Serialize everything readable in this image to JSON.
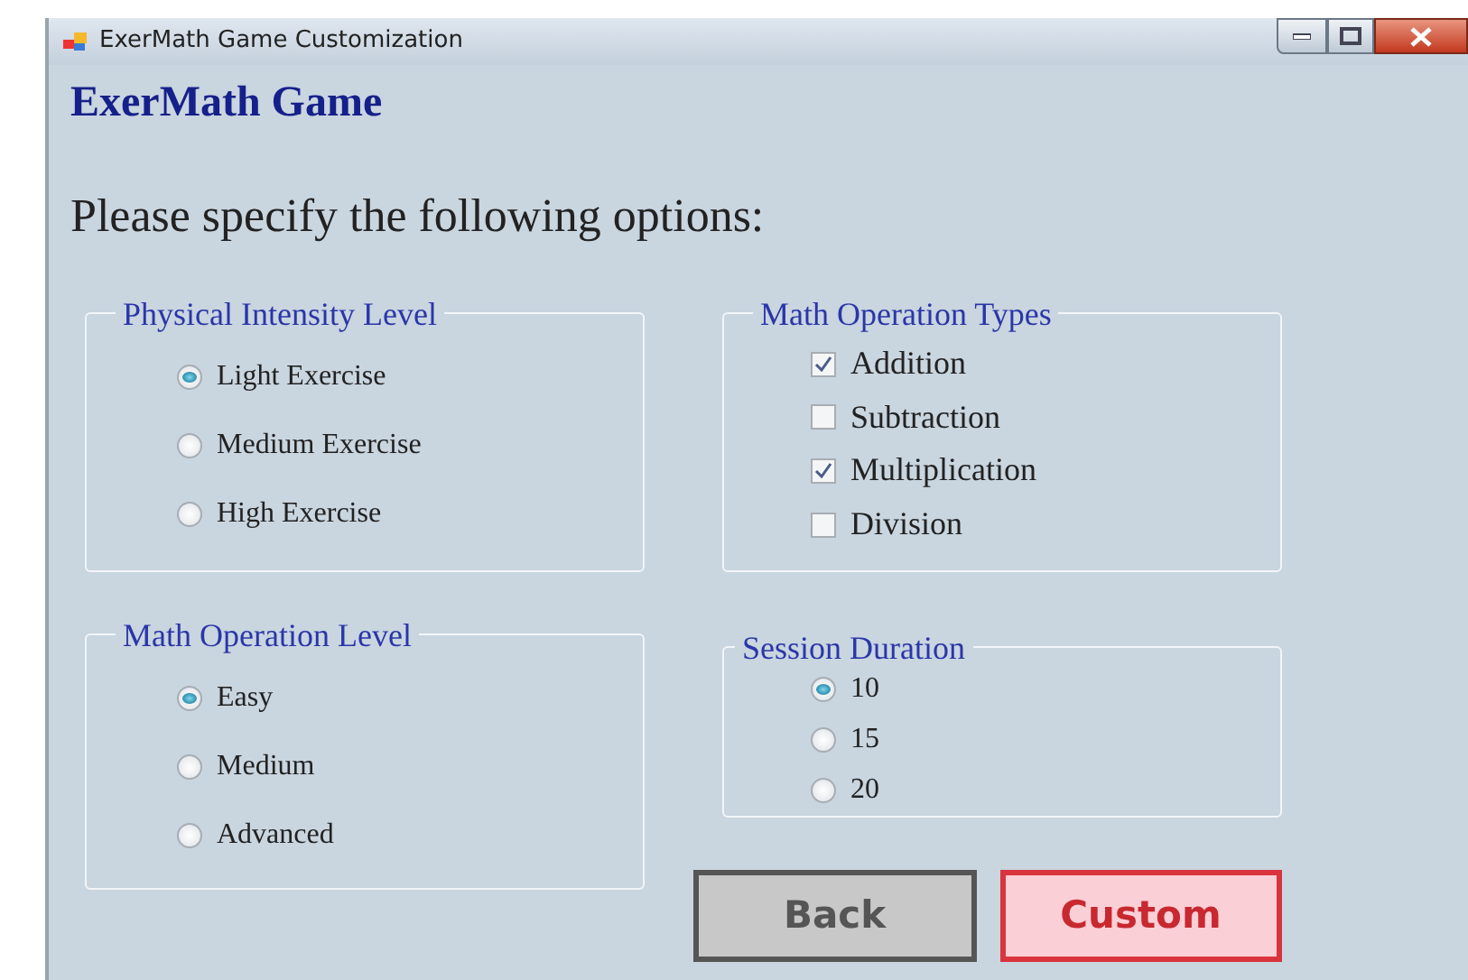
{
  "window": {
    "title": "ExerMath Game  Customization"
  },
  "heading": "ExerMath Game",
  "prompt": "Please specify the following options:",
  "groups": [
    {
      "title": "Physical Intensity Level",
      "kind": "radio",
      "items": [
        {
          "label": "Light Exercise",
          "selected": true
        },
        {
          "label": "Medium Exercise",
          "selected": false
        },
        {
          "label": "High Exercise",
          "selected": false
        }
      ]
    },
    {
      "title": "Math Operation Types",
      "kind": "checkbox",
      "items": [
        {
          "label": "Addition",
          "checked": true
        },
        {
          "label": "Subtraction",
          "checked": false
        },
        {
          "label": "Multiplication",
          "checked": true
        },
        {
          "label": "Division",
          "checked": false
        }
      ]
    },
    {
      "title": "Math Operation Level",
      "kind": "radio",
      "items": [
        {
          "label": "Easy",
          "selected": true
        },
        {
          "label": "Medium",
          "selected": false
        },
        {
          "label": "Advanced",
          "selected": false
        }
      ]
    },
    {
      "title": "Session Duration",
      "kind": "radio",
      "items": [
        {
          "label": "10",
          "selected": true
        },
        {
          "label": "15",
          "selected": false
        },
        {
          "label": "20",
          "selected": false
        }
      ]
    }
  ],
  "buttons": [
    {
      "label": "Back",
      "kind": "secondary"
    },
    {
      "label": "Custom",
      "kind": "primary"
    }
  ]
}
